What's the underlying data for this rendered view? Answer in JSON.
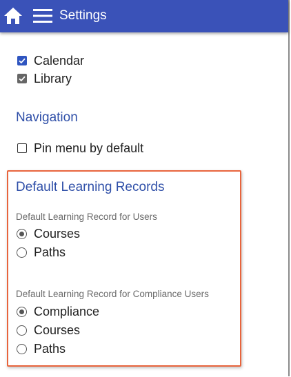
{
  "header": {
    "title": "Settings",
    "home_icon": "home-icon",
    "menu_icon": "hamburger-menu-icon",
    "background_color": "#3a52b8"
  },
  "tools": [
    {
      "label": "Calendar",
      "checked": true,
      "style": "blue"
    },
    {
      "label": "Library",
      "checked": true,
      "style": "gray"
    }
  ],
  "navigation": {
    "title": "Navigation",
    "pin_menu": {
      "label": "Pin menu by default",
      "checked": false
    }
  },
  "learning_records": {
    "title": "Default Learning Records",
    "highlight_color": "#e8643c",
    "users": {
      "label": "Default Learning Record for Users",
      "options": [
        {
          "label": "Courses",
          "selected": true
        },
        {
          "label": "Paths",
          "selected": false
        }
      ]
    },
    "compliance_users": {
      "label": "Default Learning Record for Compliance Users",
      "options": [
        {
          "label": "Compliance",
          "selected": true
        },
        {
          "label": "Courses",
          "selected": false
        },
        {
          "label": "Paths",
          "selected": false
        }
      ]
    }
  }
}
